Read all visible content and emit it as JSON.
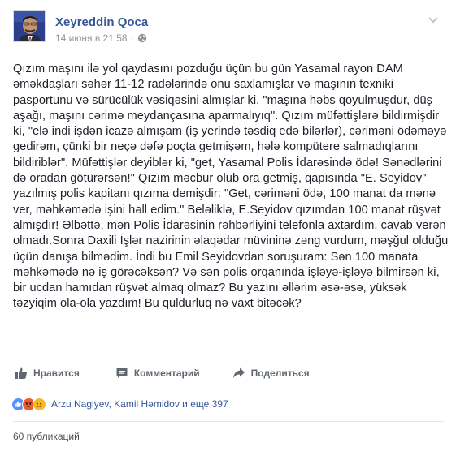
{
  "post": {
    "author": "Xeyreddin Qoca",
    "timestamp": "14 июня в 21:58",
    "separator": "·",
    "privacy_icon": "globe-icon",
    "menu_icon": "chevron-down-icon",
    "text": "Qızım maşını ilə yol qaydasını pozduğu üçün bu gün Yasamal rayon DAM əməkdaşları səhər 11-12 radələrində onu saxlamışlar və maşının texniki pasportunu və sürücülük vəsiqəsini almışlar ki, \"maşına həbs qoyulmuşdur, düş aşağı, maşını cərimə meydançasına aparmalıyıq\". Qızım müfəttişlərə bildirmişdir ki, \"elə indi işdən icazə almışam (iş yerində təsdiq edə bilərlər), cəriməni ödəməyə gedirəm, çünki bir neçə dəfə poçta getmişəm, hələ kompütere salmadıqlarını bildiriblər\". Müfəttişlər deyiblər ki, \"get, Yasamal Polis İdarəsində ödə! Sənədlərini də oradan götürərsən!\" Qızım məcbur olub ora getmiş, qapısında \"E. Seyidov\" yazılmış polis kapitanı qızıma demişdir: \"Get, cəriməni ödə, 100 manat da mənə ver, məhkəmədə işini həll edim.\" Beləliklə, E.Seyidov qızımdan 100 manat rüşvət almışdır! Əlbəttə, mən Polis İdarəsinin rəhbərliyini telefonla axtardım, cavab verən olmadı.Sonra Daxili İşlər nazirinin əlaqədar müvininə zəng vurdum, məşğul olduğu üçün danışa bilmədim. İndi bu Emil Seyidovdan soruşuram: Sən 100 manata məhkəmədə nə iş görəcəksən? Və sən polis orqanında işləyə-işləyə bilmirsən ki, bir ucdan hamıdan rüşvət almaq olmaz? Bu yazını əllərim əsə-əsə, yüksək təzyiqim ola-ola yazdım! Bu quldurluq nə vaxt bitəcək?"
  },
  "actions": {
    "like_label": "Нравится",
    "comment_label": "Комментарий",
    "share_label": "Поделиться"
  },
  "reactions": {
    "icons": [
      "like",
      "angry",
      "sad"
    ],
    "summary": "Arzu Nagiyev, Kamil Həmidov и еще 397"
  },
  "shares": {
    "label": "60 публикаций"
  },
  "colors": {
    "link": "#365899",
    "meta": "#90949c",
    "like_blue": "#5890ff",
    "angry_orange": "#f05c2c",
    "sad_yellow": "#f7b928"
  }
}
